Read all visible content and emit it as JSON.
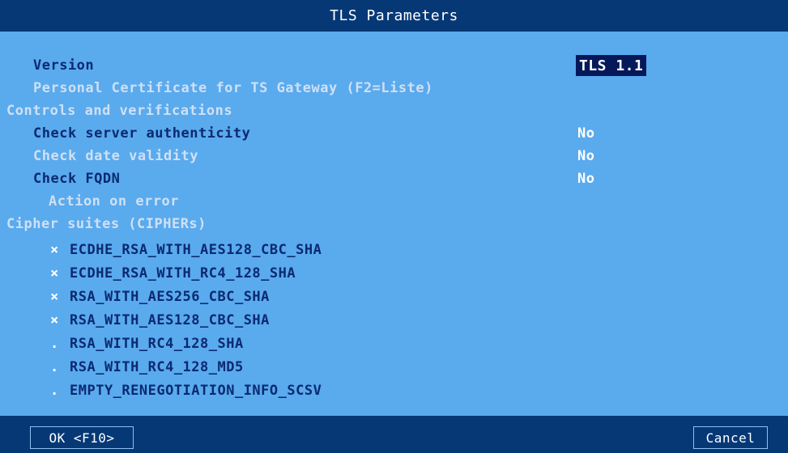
{
  "window": {
    "title": "TLS Parameters"
  },
  "fields": {
    "version_label": "Version",
    "version_value": "TLS 1.1",
    "personal_cert_label": "Personal Certificate for TS Gateway (F2=Liste)"
  },
  "controls": {
    "header": "Controls and verifications",
    "check_server_label": "Check server authenticity",
    "check_server_value": "No",
    "check_date_label": "Check date validity",
    "check_date_value": "No",
    "check_fqdn_label": "Check FQDN",
    "check_fqdn_value": "No",
    "action_on_error_label": "Action on error"
  },
  "ciphers": {
    "header": "Cipher suites (CIPHERs)",
    "items": [
      {
        "mark": "×",
        "name": "ECDHE_RSA_WITH_AES128_CBC_SHA"
      },
      {
        "mark": "×",
        "name": "ECDHE_RSA_WITH_RC4_128_SHA"
      },
      {
        "mark": "×",
        "name": "RSA_WITH_AES256_CBC_SHA"
      },
      {
        "mark": "×",
        "name": "RSA_WITH_AES128_CBC_SHA"
      },
      {
        "mark": ".",
        "name": "RSA_WITH_RC4_128_SHA"
      },
      {
        "mark": ".",
        "name": "RSA_WITH_RC4_128_MD5"
      },
      {
        "mark": ".",
        "name": "EMPTY_RENEGOTIATION_INFO_SCSV"
      }
    ]
  },
  "footer": {
    "ok_label": "OK <F10>",
    "cancel_label": "Cancel"
  },
  "colors": {
    "background": "#5aaaee",
    "titlebar": "#063876",
    "active_text": "#0b2a70",
    "inactive_text": "#cfe0f4",
    "selection": "#05185a"
  }
}
